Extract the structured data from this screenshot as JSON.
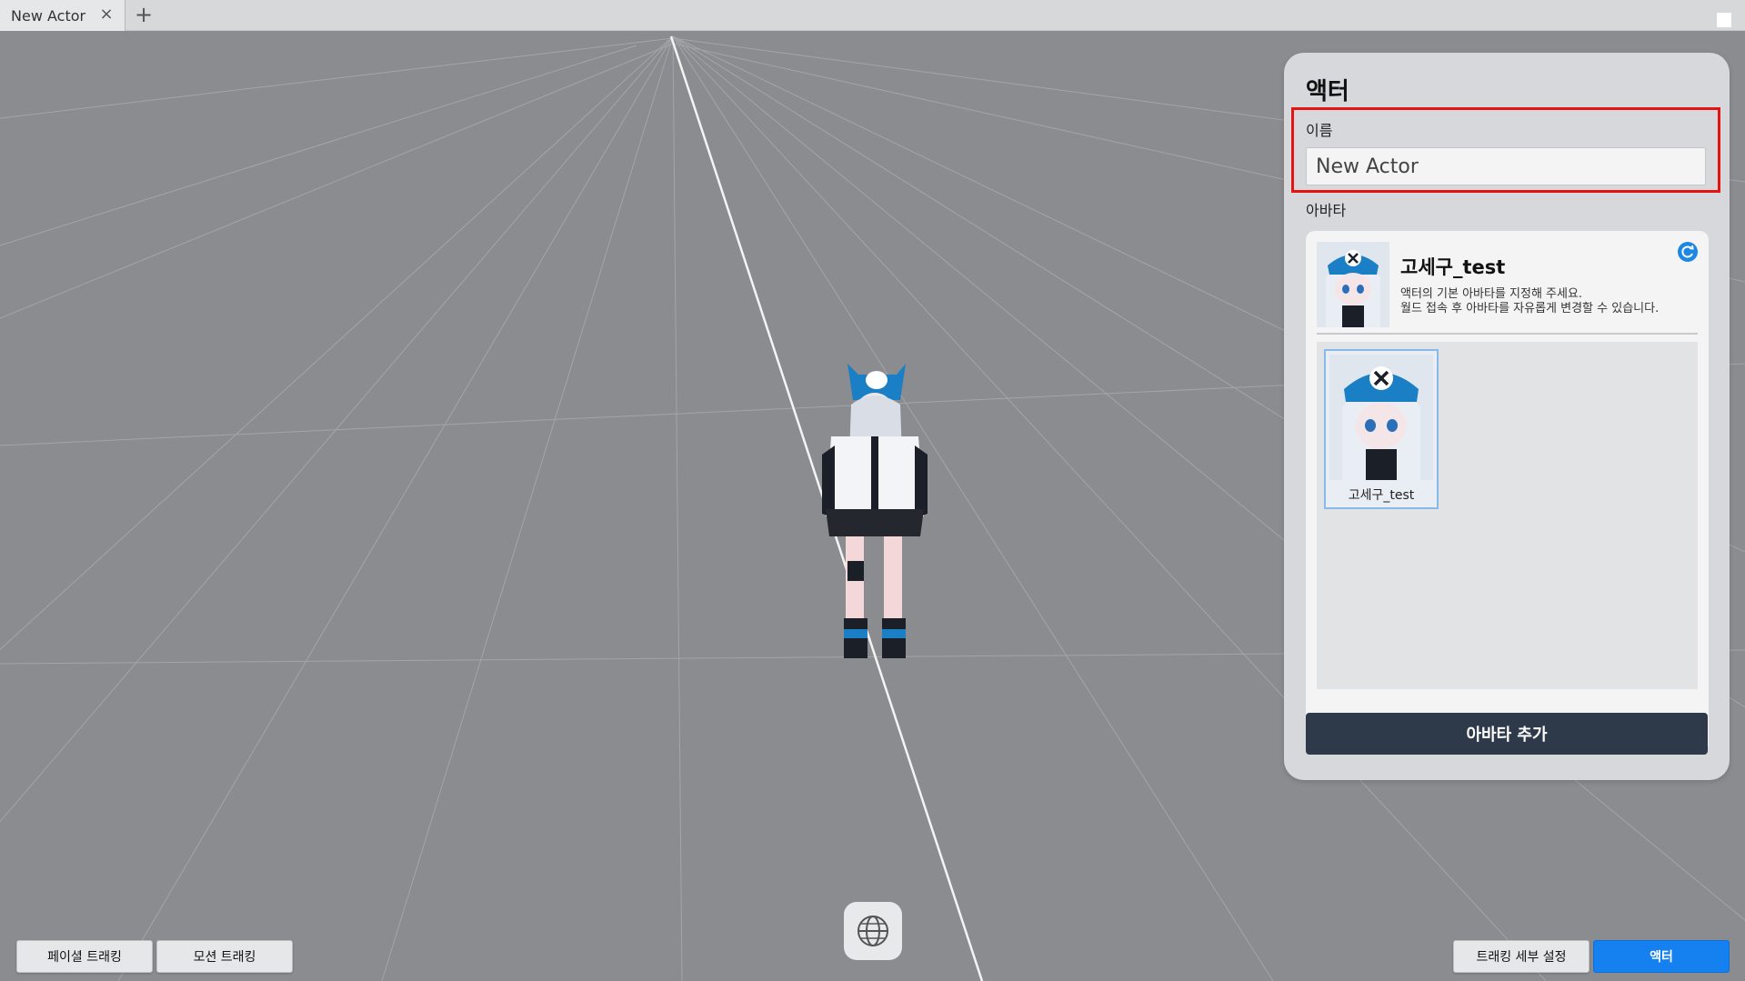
{
  "tabs": [
    {
      "label": "New Actor"
    }
  ],
  "tab_close": "×",
  "tab_add": "+",
  "gizmo_axis": "y",
  "panel": {
    "title": "액터",
    "name_label": "이름",
    "name_value": "New Actor",
    "avatar_label": "아바타",
    "current_avatar": {
      "name": "고세구_test",
      "desc_line1": "액터의 기본 아바타를 지정해 주세요.",
      "desc_line2": "월드 접속 후 아바타를 자유롭게 변경할 수 있습니다."
    },
    "avatar_list": [
      {
        "caption": "고세구_test"
      }
    ],
    "add_button": "아바타 추가"
  },
  "bottom_left": {
    "facial_tracking": "페이셜 트래킹",
    "motion_tracking": "모션 트래킹"
  },
  "bottom_right": {
    "tracking_settings": "트래킹 세부 설정",
    "actor": "액터"
  },
  "colors": {
    "accent_blue": "#1580f0",
    "dark_button": "#2e3a4a",
    "highlight_red": "#e31414",
    "viewport_bg": "#8a8c90"
  }
}
